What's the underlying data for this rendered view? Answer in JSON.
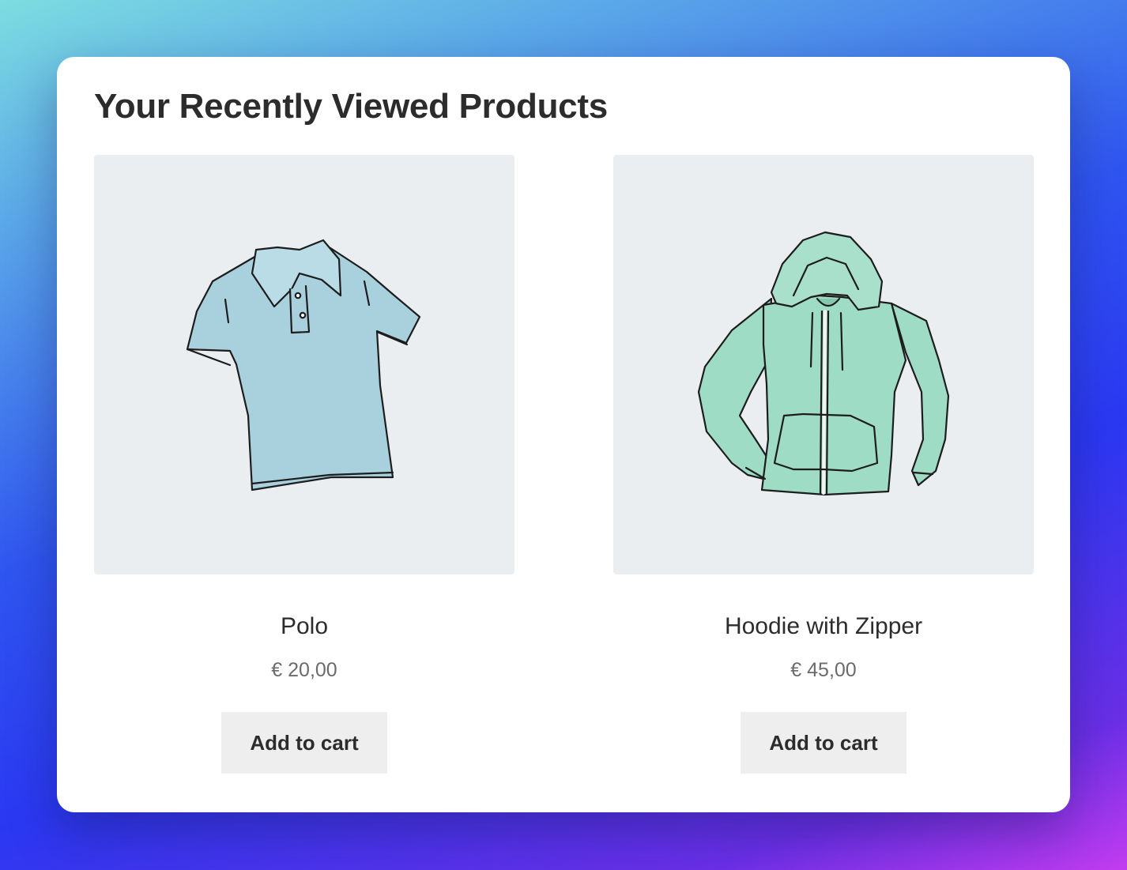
{
  "section": {
    "title": "Your Recently Viewed Products"
  },
  "products": [
    {
      "name": "Polo",
      "price": "€ 20,00",
      "button_label": "Add to cart",
      "image_icon": "polo-shirt-icon",
      "image_color": "#a9d1dd"
    },
    {
      "name": "Hoodie with Zipper",
      "price": "€ 45,00",
      "button_label": "Add to cart",
      "image_icon": "zip-hoodie-icon",
      "image_color": "#9fdcc6"
    }
  ],
  "colors": {
    "card_bg": "#ffffff",
    "thumb_bg": "#ebeef1",
    "button_bg": "#eeeeee",
    "text": "#2c2c2c",
    "price_text": "#6b6b6b"
  }
}
